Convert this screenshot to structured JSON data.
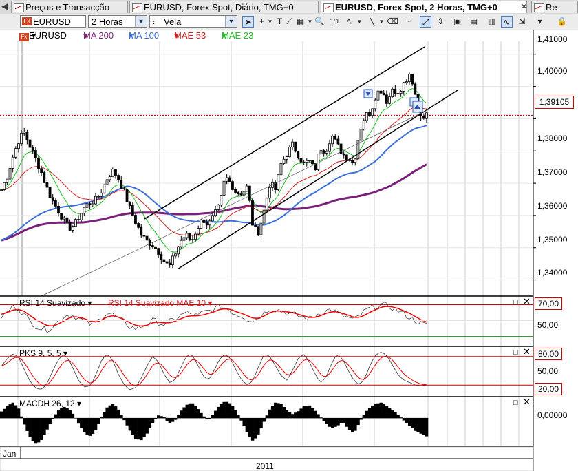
{
  "tabs": [
    {
      "label": "Preços e Transacção"
    },
    {
      "label": "EURUSD, Forex Spot, Diário, TMG+0"
    },
    {
      "label": "EURUSD, Forex Spot, 2 Horas, TMG+0"
    },
    {
      "label": "Re"
    }
  ],
  "toolbar": {
    "symbol": "EURUSD",
    "interval": "2 Horas",
    "chart_style": "Vela"
  },
  "legend": {
    "symbol": "EURUSD",
    "ma200": "MA 200",
    "ma100": "MA 100",
    "mae53": "MAE 53",
    "mae23": "MAE 23",
    "colors": {
      "ma200": "#7a1f7a",
      "ma100": "#3a6fd8",
      "mae53": "#d02020",
      "mae23": "#20c020"
    }
  },
  "price_axis": {
    "labels": [
      "1,41000",
      "1,40000",
      "1,39105",
      "1,38000",
      "1,37000",
      "1,36000",
      "1,35000",
      "1,34000"
    ],
    "current_price": "1,39105"
  },
  "rsi_panel": {
    "title": "RSI 14 Suavizado",
    "title2": "RSI 14 Suavizado MAE 10",
    "upper": "70,00",
    "mid": "50,00"
  },
  "pks_panel": {
    "title": "PKS 9, 5, 5",
    "upper": "80,00",
    "mid": "50,00",
    "lower": "20,00"
  },
  "macd_panel": {
    "title": "MACDH 26, 12",
    "zero": "0,00000"
  },
  "x_axis": {
    "start": "Jan",
    "year": "2011"
  },
  "chart_data": {
    "type": "candlestick",
    "ylim": [
      1.335,
      1.414
    ],
    "close_path": [
      1.368,
      1.372,
      1.378,
      1.383,
      1.386,
      1.382,
      1.378,
      1.374,
      1.369,
      1.365,
      1.362,
      1.359,
      1.356,
      1.357,
      1.36,
      1.363,
      1.364,
      1.365,
      1.368,
      1.372,
      1.374,
      1.371,
      1.367,
      1.362,
      1.358,
      1.354,
      1.352,
      1.351,
      1.349,
      1.346,
      1.344,
      1.348,
      1.352,
      1.354,
      1.352,
      1.356,
      1.359,
      1.357,
      1.36,
      1.363,
      1.372,
      1.37,
      1.367,
      1.367,
      1.369,
      1.356,
      1.355,
      1.362,
      1.37,
      1.368,
      1.376,
      1.379,
      1.382,
      1.379,
      1.376,
      1.377,
      1.374,
      1.381,
      1.38,
      1.385,
      1.382,
      1.379,
      1.378,
      1.376,
      1.386,
      1.391,
      1.392,
      1.398,
      1.399,
      1.395,
      1.4,
      1.397,
      1.401,
      1.403,
      1.397,
      1.391,
      1.391
    ],
    "rsi": [
      55,
      60,
      68,
      66,
      58,
      50,
      44,
      40,
      38,
      42,
      48,
      55,
      58,
      56,
      52,
      48,
      45,
      48,
      55,
      60,
      57,
      52,
      48,
      42,
      40,
      42,
      46,
      50,
      48,
      45,
      48,
      52,
      56,
      60,
      58,
      55,
      60,
      62,
      64,
      68,
      66,
      62,
      58,
      56,
      52,
      50,
      54,
      60,
      66,
      64,
      62,
      60,
      58,
      56,
      54,
      52,
      56,
      60,
      62,
      64,
      60,
      56,
      54,
      50,
      56,
      62,
      66,
      68,
      70,
      68,
      66,
      62,
      58,
      54,
      50,
      46,
      44
    ],
    "rsi_mae": [
      58,
      60,
      63,
      64,
      62,
      57,
      52,
      48,
      44,
      43,
      45,
      49,
      53,
      55,
      54,
      52,
      49,
      48,
      51,
      55,
      56,
      54,
      51,
      47,
      44,
      43,
      44,
      47,
      48,
      47,
      47,
      49,
      52,
      55,
      56,
      56,
      57,
      59,
      61,
      64,
      65,
      64,
      61,
      59,
      56,
      53,
      53,
      56,
      60,
      62,
      62,
      61,
      60,
      58,
      56,
      54,
      54,
      56,
      59,
      61,
      61,
      59,
      57,
      54,
      54,
      57,
      61,
      64,
      67,
      68,
      67,
      65,
      62,
      59,
      55,
      51,
      48
    ],
    "pks": [
      60,
      75,
      85,
      80,
      55,
      30,
      15,
      10,
      20,
      45,
      70,
      85,
      75,
      50,
      25,
      15,
      20,
      45,
      75,
      85,
      70,
      40,
      20,
      10,
      15,
      35,
      60,
      80,
      70,
      45,
      25,
      30,
      55,
      80,
      85,
      65,
      40,
      30,
      50,
      75,
      85,
      75,
      50,
      30,
      20,
      30,
      60,
      85,
      80,
      60,
      40,
      30,
      50,
      75,
      85,
      70,
      45,
      25,
      35,
      65,
      85,
      75,
      50,
      30,
      20,
      35,
      65,
      85,
      90,
      80,
      60,
      40,
      30,
      25,
      20,
      18,
      20
    ],
    "macdh": [
      0.0005,
      0.0009,
      0.0012,
      0.0008,
      -0.0004,
      -0.0014,
      -0.002,
      -0.0018,
      -0.001,
      -0.0002,
      0.0005,
      0.0009,
      0.0007,
      0.0002,
      -0.0006,
      -0.0012,
      -0.0014,
      -0.0008,
      0.0002,
      0.0009,
      0.0011,
      0.0006,
      -0.0002,
      -0.001,
      -0.0016,
      -0.0017,
      -0.0012,
      -0.0004,
      0.0002,
      0.0001,
      -0.0004,
      -0.0002,
      0.0005,
      0.001,
      0.0012,
      0.0008,
      0.0002,
      -0.0002,
      0.0004,
      0.001,
      0.0013,
      0.0011,
      0.0005,
      -0.0003,
      -0.0012,
      -0.0018,
      -0.0012,
      -0.0002,
      0.0007,
      0.0012,
      0.0011,
      0.0006,
      0.0003,
      0.0005,
      0.0009,
      0.001,
      0.0006,
      0.0001,
      -0.0004,
      -0.0008,
      -0.0006,
      -0.0003,
      -0.0008,
      -0.0012,
      -0.0003,
      0.0004,
      0.0009,
      0.0011,
      0.0012,
      0.0009,
      0.0006,
      0.0002,
      -0.0002,
      -0.0006,
      -0.001,
      -0.0012,
      -0.0014
    ]
  }
}
